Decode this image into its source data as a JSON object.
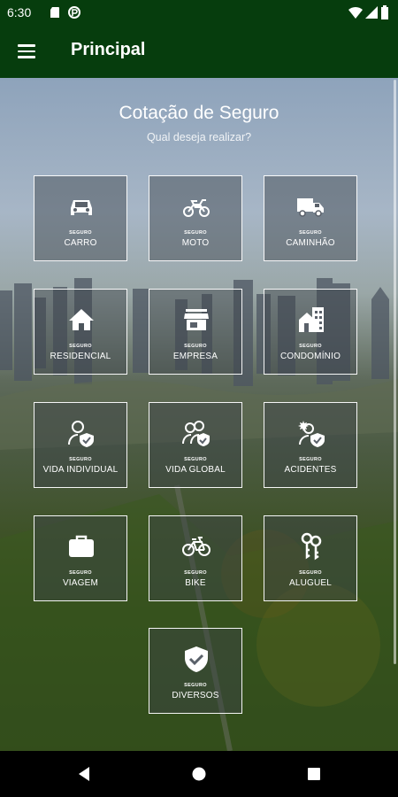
{
  "status_bar": {
    "time": "6:30"
  },
  "app_bar": {
    "title": "Principal"
  },
  "main": {
    "title": "Cotação de Seguro",
    "subtitle": "Qual deseja realizar?",
    "tiles": [
      {
        "small": "SEGURO",
        "name": "CARRO",
        "icon": "car-icon"
      },
      {
        "small": "SEGURO",
        "name": "MOTO",
        "icon": "motorcycle-icon"
      },
      {
        "small": "SEGURO",
        "name": "CAMINHÃO",
        "icon": "truck-icon"
      },
      {
        "small": "SEGURO",
        "name": "RESIDENCIAL",
        "icon": "house-icon"
      },
      {
        "small": "SEGURO",
        "name": "EMPRESA",
        "icon": "store-icon"
      },
      {
        "small": "SEGURO",
        "name": "CONDOMÍNIO",
        "icon": "building-icon"
      },
      {
        "small": "SEGURO",
        "name": "VIDA INDIVIDUAL",
        "icon": "person-shield-icon"
      },
      {
        "small": "SEGURO",
        "name": "VIDA GLOBAL",
        "icon": "people-shield-icon"
      },
      {
        "small": "SEGURO",
        "name": "ACIDENTES",
        "icon": "person-alert-shield-icon"
      },
      {
        "small": "SEGURO",
        "name": "VIAGEM",
        "icon": "suitcase-icon"
      },
      {
        "small": "SEGURO",
        "name": "BIKE",
        "icon": "bicycle-icon"
      },
      {
        "small": "SEGURO",
        "name": "ALUGUEL",
        "icon": "keys-icon"
      },
      {
        "small": "SEGURO",
        "name": "DIVERSOS",
        "icon": "shield-check-icon"
      }
    ]
  },
  "colors": {
    "app_bar": "#063d0d",
    "nav_bar": "#000000",
    "tile_border": "#ffffff"
  }
}
